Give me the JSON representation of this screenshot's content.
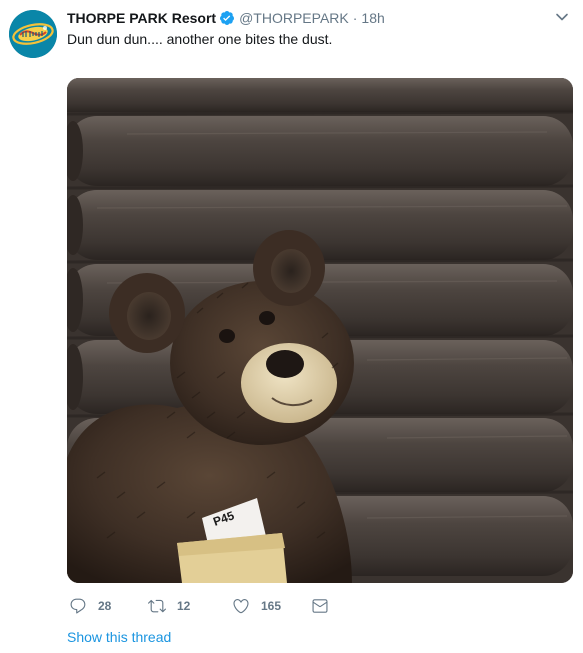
{
  "tweet": {
    "display_name": "THORPE PARK Resort",
    "handle": "@THORPEPARK",
    "separator": "·",
    "time": "18h",
    "text": "Dun dun dun.... another one bites the dust.",
    "media": {
      "document_label": "P45"
    },
    "actions": {
      "reply_count": "28",
      "retweet_count": "12",
      "like_count": "165"
    },
    "show_thread_label": "Show this thread"
  },
  "colors": {
    "link": "#1b95e0",
    "muted": "#657786",
    "text": "#14171a",
    "verified": "#1da1f2"
  },
  "icons": {
    "avatar": "thorpe-park-logo",
    "verified": "verified-badge-icon",
    "caret": "chevron-down-icon",
    "reply": "reply-icon",
    "retweet": "retweet-icon",
    "like": "heart-icon",
    "dm": "envelope-icon"
  }
}
